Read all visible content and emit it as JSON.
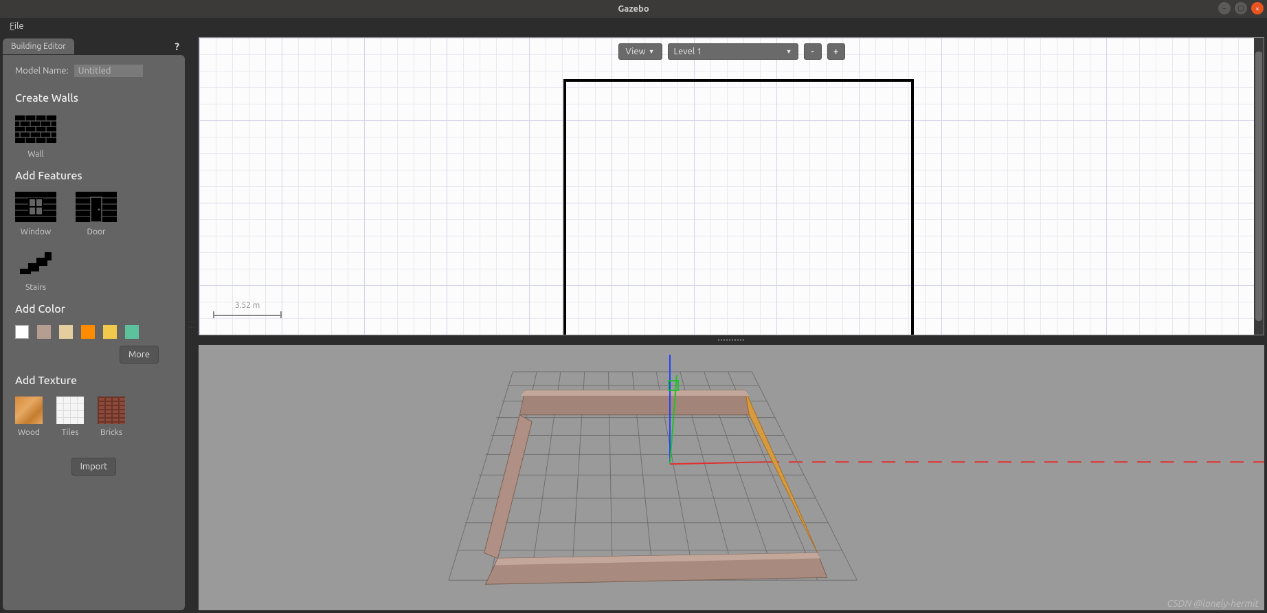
{
  "window": {
    "title": "Gazebo"
  },
  "menubar": {
    "file": "File"
  },
  "sidebar": {
    "tab": "Building Editor",
    "help": "?",
    "model_name_label": "Model Name:",
    "model_name_value": "Untitled",
    "sections": {
      "create_walls": "Create Walls",
      "add_features": "Add Features",
      "add_color": "Add Color",
      "add_texture": "Add Texture"
    },
    "items": {
      "wall": "Wall",
      "window": "Window",
      "door": "Door",
      "stairs": "Stairs"
    },
    "colors": [
      "#ffffff",
      "#b59e91",
      "#e6cda0",
      "#ff8c00",
      "#f0c94d",
      "#5bc29d"
    ],
    "more": "More",
    "textures": {
      "wood": "Wood",
      "tiles": "Tiles",
      "bricks": "Bricks"
    },
    "import": "Import"
  },
  "toolbar2d": {
    "view": "View",
    "level": "Level 1",
    "minus": "-",
    "plus": "+"
  },
  "scale": {
    "label": "3.52 m"
  },
  "watermark": "CSDN @lonely-hermit"
}
